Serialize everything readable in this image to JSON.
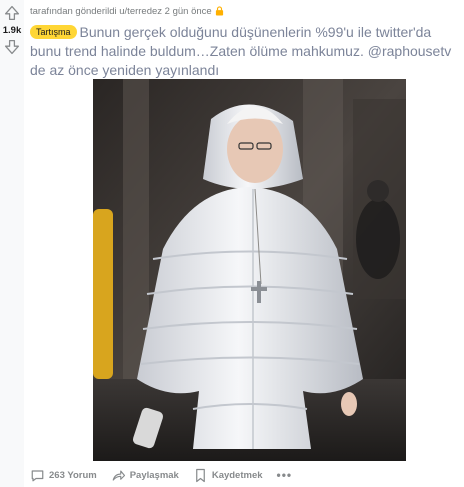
{
  "vote": {
    "score": "1.9k"
  },
  "post": {
    "meta": "tarafından gönderildi u/terredez 2 gün önce",
    "flair": "Tartışma",
    "title": "Bunun gerçek olduğunu düşünenlerin %99'u ile twitter'da bunu trend halinde buldum…Zaten ölüme mahkumuz. @raphousetv de az önce yeniden yayınlandı"
  },
  "actions": {
    "comments": "263 Yorum",
    "share": "Paylaşmak",
    "save": "Kaydetmek",
    "more": "•••"
  },
  "colors": {
    "flair_bg": "#ffd635",
    "lock": "#ffb000",
    "title": "#7c8499"
  }
}
